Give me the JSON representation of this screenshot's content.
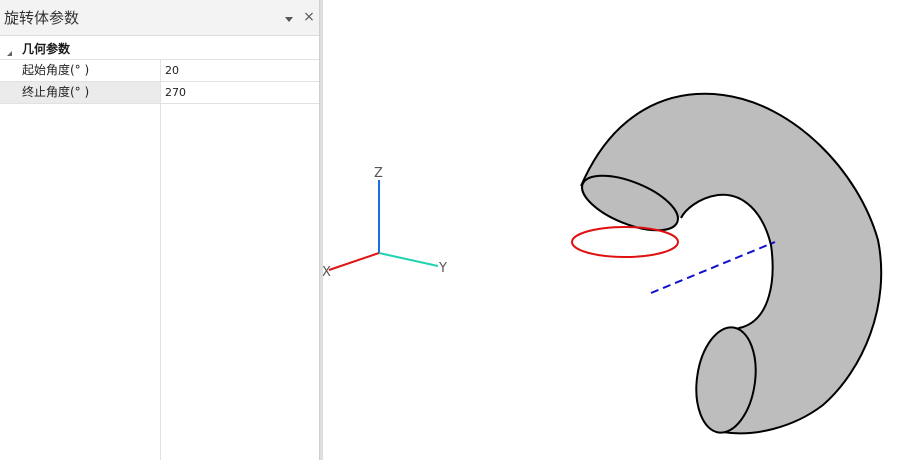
{
  "panel": {
    "title": "旋转体参数",
    "dropdown_icon": "triangle-down-icon",
    "close_glyph": "×",
    "category": {
      "label": "几何参数",
      "expanded": true
    },
    "properties": [
      {
        "name": "起始角度(° )",
        "value": "20",
        "selected": false
      },
      {
        "name": "终止角度(° )",
        "value": "270",
        "selected": true
      }
    ]
  },
  "viewport": {
    "axes": {
      "x_label": "X",
      "y_label": "Y",
      "z_label": "Z",
      "x_color": "#e01515",
      "y_color": "#1fd3b0",
      "z_color": "#1a6fe0"
    },
    "solid": {
      "fill_color": "#bdbdbd",
      "outline_color": "#000000",
      "profile_circle_color": "#e01010",
      "rotation_axis_color": "#1010d0",
      "start_angle_deg": 20,
      "end_angle_deg": 270
    }
  }
}
